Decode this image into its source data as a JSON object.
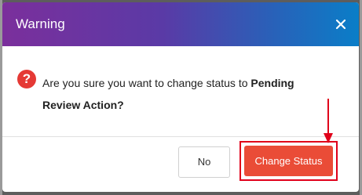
{
  "dialog": {
    "title": "Warning",
    "message_prefix": "Are you sure you want to change status to ",
    "message_status": "Pending Review Action?",
    "buttons": {
      "no_label": "No",
      "confirm_label": "Change Status"
    },
    "icons": {
      "close": "close-icon",
      "question": "question-icon",
      "annotation": "arrow-down-icon"
    },
    "colors": {
      "header_start": "#7b2f9c",
      "header_end": "#0a7ec8",
      "confirm_button": "#ea4c37",
      "question_icon": "#e53935",
      "annotation": "#e0001a"
    }
  }
}
